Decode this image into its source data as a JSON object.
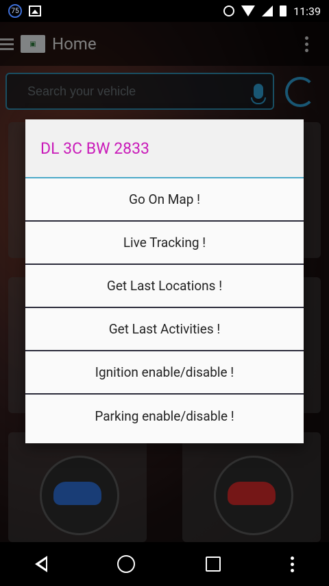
{
  "status_bar": {
    "notification_count": "75",
    "time": "11:39",
    "icons": [
      "notification-badge",
      "image-icon",
      "alarm-icon",
      "wifi-icon",
      "signal-icon",
      "battery-icon"
    ]
  },
  "app_bar": {
    "title": "Home",
    "icons": [
      "menu-icon",
      "app-logo",
      "overflow-menu-icon"
    ]
  },
  "search": {
    "placeholder": "Search your vehicle",
    "icons": [
      "mic-icon",
      "refresh-icon"
    ]
  },
  "dialog": {
    "title": "DL 3C BW 2833",
    "title_color": "#c91ab9",
    "divider_color": "#4ba9c8",
    "options": [
      {
        "label": "Go On Map !"
      },
      {
        "label": "Live Tracking !"
      },
      {
        "label": "Get Last Locations !"
      },
      {
        "label": "Get Last Activities !"
      },
      {
        "label": "Ignition enable/disable !"
      },
      {
        "label": "Parking enable/disable !"
      }
    ]
  },
  "nav_bar": {
    "icons": [
      "back-icon",
      "home-icon",
      "recent-apps-icon",
      "more-icon"
    ]
  }
}
